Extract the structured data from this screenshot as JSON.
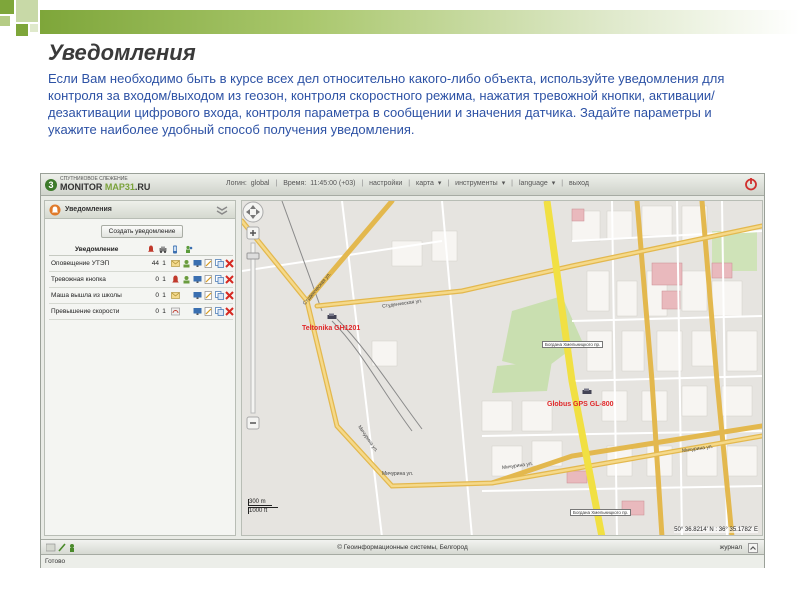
{
  "slide": {
    "title": "Уведомления",
    "text": "Если Вам необходимо быть в курсе всех дел относительно какого-либо объекта, используйте уведомления для контроля за входом/выходом из геозон, контроля скоростного режима, нажатия тревожной кнопки, активации/дезактивации цифрового входа, контроля параметра в сообщении и значения датчика. Задайте параметры и укажите наиболее удобный способ получения уведомления."
  },
  "app": {
    "logo_small": "СПУТНИКОВОЕ СЛЕЖЕНИЕ",
    "logo_main": "MONITOR",
    "logo_map": "MAP31",
    "logo_suffix": ".RU",
    "menu": {
      "login_label": "Логин:",
      "login_value": "global",
      "time_label": "Время:",
      "time_value": "11:45:00 (+03)",
      "settings": "настройки",
      "map": "карта",
      "tools": "инструменты",
      "language": "language",
      "exit": "выход"
    },
    "panel": {
      "title": "Уведомления",
      "create_button": "Создать уведомление",
      "column_header": "Уведомление",
      "rows": [
        {
          "name": "Оповещение УТЭП",
          "count1": "44",
          "count2": "1"
        },
        {
          "name": "Тревожная кнопка",
          "count1": "0",
          "count2": "1"
        },
        {
          "name": "Маша вышла из школы",
          "count1": "0",
          "count2": "1"
        },
        {
          "name": "Превышение скорости",
          "count1": "0",
          "count2": "1"
        }
      ]
    },
    "map": {
      "unit1_label": "Teltonika GH1201",
      "unit2_label": "Globus GPS GL-800",
      "streets": [
        "Студенческая ул.",
        "Студенческая ул.",
        "Мичурина ул.",
        "Мичурина ул.",
        "Мичурина ул.",
        "Мичурина ул."
      ],
      "signs": [
        "Богдана Хмельницкого пр.",
        "Богдана Хмельницкого пр."
      ],
      "scale_top": "300 m",
      "scale_bottom": "1000 ft",
      "coords": "50° 36.8214' N : 36° 35.1782' E"
    },
    "bottom": {
      "copyright": "© Геоинформационные системы, Белгород",
      "journal": "журнал"
    },
    "status": "Готово"
  }
}
